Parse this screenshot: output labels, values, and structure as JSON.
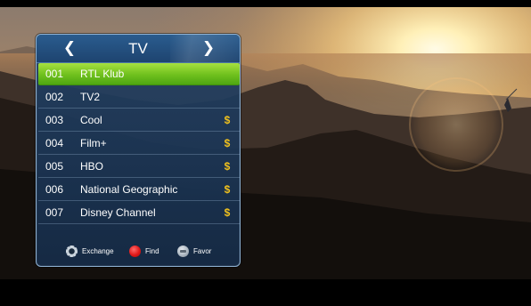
{
  "panel": {
    "title": "TV",
    "prev_icon": "chevron-left-icon",
    "next_icon": "chevron-right-icon"
  },
  "channels": [
    {
      "number": "001",
      "name": "RTL Klub",
      "pay_symbol": "",
      "selected": true
    },
    {
      "number": "002",
      "name": "TV2",
      "pay_symbol": "",
      "selected": false
    },
    {
      "number": "003",
      "name": "Cool",
      "pay_symbol": "$",
      "selected": false
    },
    {
      "number": "004",
      "name": "Film+",
      "pay_symbol": "$",
      "selected": false
    },
    {
      "number": "005",
      "name": "HBO",
      "pay_symbol": "$",
      "selected": false
    },
    {
      "number": "006",
      "name": "National Geographic",
      "pay_symbol": "$",
      "selected": false
    },
    {
      "number": "007",
      "name": "Disney Channel",
      "pay_symbol": "$",
      "selected": false
    }
  ],
  "footer": {
    "exchange": {
      "label": "Exchange",
      "icon": "exchange-key-icon"
    },
    "find": {
      "label": "Find",
      "icon": "red-key-icon"
    },
    "favor": {
      "label": "Favor",
      "icon": "favor-key-icon"
    }
  },
  "colors": {
    "selected_row": "#6fc01d",
    "pay_symbol": "#f0c11d",
    "panel_bg": "#1e4470",
    "find_key": "#e01818"
  }
}
